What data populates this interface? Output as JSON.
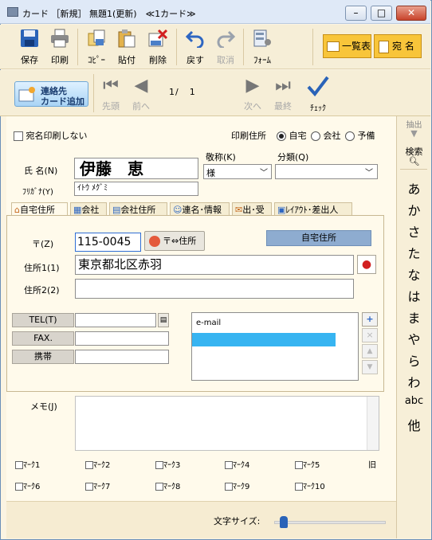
{
  "window": {
    "title": "カード ［新規］ 無題1(更新)　≪1カード≫",
    "minimize": "–",
    "maximize": "□",
    "close": "✕"
  },
  "toolbar": {
    "save": "保存",
    "print": "印刷",
    "copy": "ｺﾋﾟｰ",
    "paste": "貼付",
    "delete": "削除",
    "undo": "戻す",
    "cancel": "取消",
    "form": "ﾌｫｰﾑ",
    "list": "一覧表",
    "address": "宛 名"
  },
  "nav": {
    "add_contact_line1": "連絡先",
    "add_contact_line2": "カード追加",
    "first": "先頭",
    "prev": "前へ",
    "page_current": "1",
    "page_sep": "/",
    "page_total": "1",
    "next": "次へ",
    "last": "最終",
    "check": "ﾁｪｯｸ"
  },
  "side": {
    "extract": "抽出",
    "search": "検索",
    "kana": [
      "あ",
      "か",
      "さ",
      "た",
      "な",
      "は",
      "ま",
      "や",
      "ら",
      "わ",
      "abc",
      "他"
    ]
  },
  "form": {
    "no_address_print": "宛名印刷しない",
    "print_address_label": "印刷住所",
    "print_options": [
      "自宅",
      "会社",
      "予備"
    ],
    "name_label": "氏 名(N)",
    "name_value": "伊藤　恵",
    "furigana_label": "ﾌﾘｶﾞﾅ(Y)",
    "furigana_value": "ｲﾄｳ ﾒｸﾞﾐ",
    "honorific_label": "敬称(K)",
    "honorific_value": "様",
    "category_label": "分類(Q)",
    "category_value": ""
  },
  "tabs": [
    "自宅住所",
    "会社",
    "会社住所",
    "連名･情報",
    "出･受",
    "ﾚｲｱｳﾄ･差出人"
  ],
  "home": {
    "zip_label": "〒(Z)",
    "zip_value": "115-0045",
    "zip_convert_button": "〒⇔住所",
    "section_label": "自宅住所",
    "address1_label": "住所1(1)",
    "address1_value": "東京都北区赤羽",
    "address2_label": "住所2(2)",
    "address2_value": "",
    "tel_label": "TEL(T)",
    "fax_label": "FAX.",
    "mobile_label": "携帯",
    "tel_value": "",
    "fax_value": "",
    "mobile_value": "",
    "email_header": "e-mail"
  },
  "memo": {
    "label": "メモ(J)",
    "value": ""
  },
  "marks": [
    "ﾏｰｸ1",
    "ﾏｰｸ2",
    "ﾏｰｸ3",
    "ﾏｰｸ4",
    "ﾏｰｸ5",
    "ﾏｰｸ6",
    "ﾏｰｸ7",
    "ﾏｰｸ8",
    "ﾏｰｸ9",
    "ﾏｰｸ10"
  ],
  "mark_side": "旧",
  "footer": {
    "font_size_label": "文字サイズ:",
    "font_size_level": 0.05
  }
}
